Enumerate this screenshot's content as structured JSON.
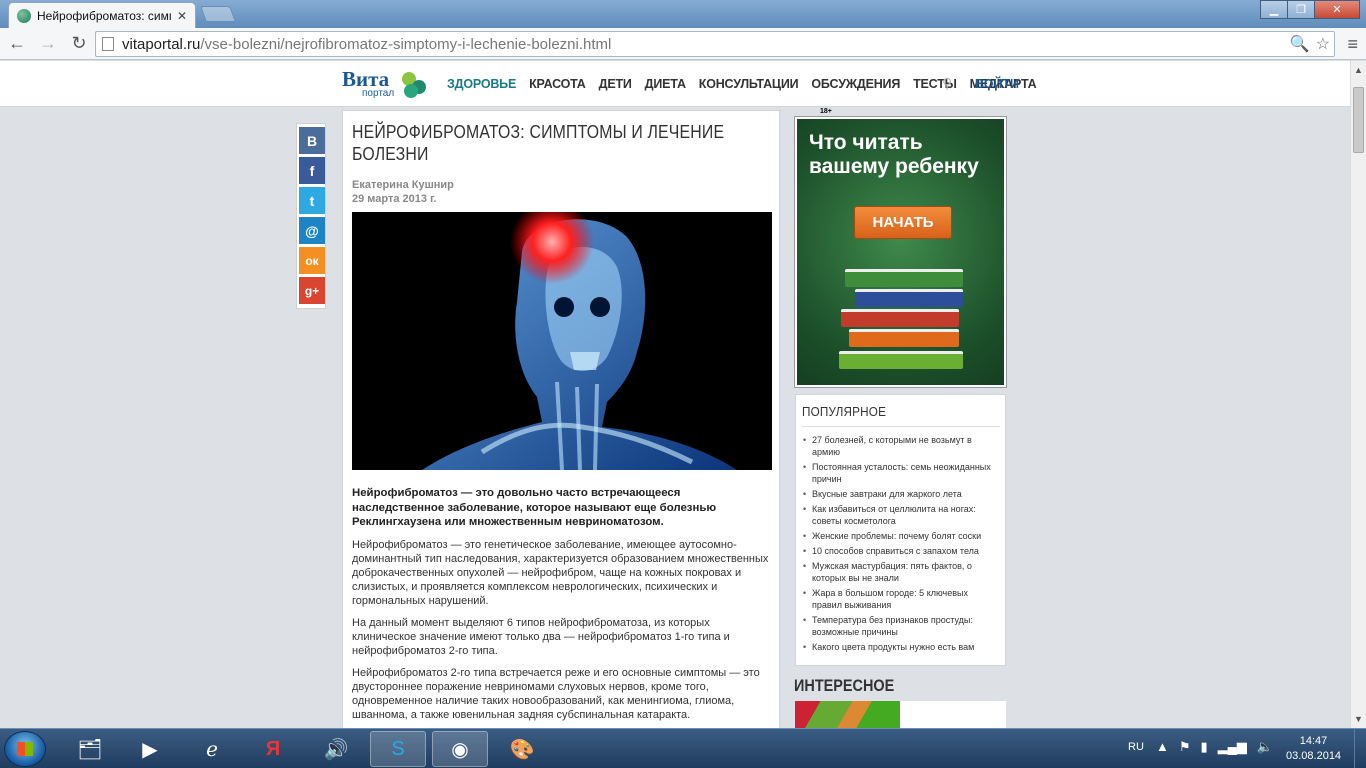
{
  "browser": {
    "tab_title": "Нейрофиброматоз: симг",
    "tab_close": "✕",
    "url_host": "vitaportal.ru",
    "url_path": "/vse-bolezni/nejrofibromatoz-simptomy-i-lechenie-bolezni.html",
    "window_buttons": {
      "minimize": "▁",
      "maximize": "❐",
      "close": "✕"
    }
  },
  "site": {
    "logo_word": "Вита",
    "logo_sub": "портал",
    "nav": [
      "ЗДОРОВЬЕ",
      "КРАСОТА",
      "ДЕТИ",
      "ДИЕТА",
      "КОНСУЛЬТАЦИИ",
      "ОБСУЖДЕНИЯ",
      "ТЕСТЫ",
      "МЕДКАРТА"
    ],
    "login": "ВОЙТИ"
  },
  "share": [
    {
      "label": "B",
      "color": "#4a6d9c",
      "icon": "vk-icon"
    },
    {
      "label": "f",
      "color": "#3b5a9a",
      "icon": "facebook-icon"
    },
    {
      "label": "t",
      "color": "#2fa9e1",
      "icon": "twitter-icon"
    },
    {
      "label": "@",
      "color": "#1e84c6",
      "icon": "mail-icon"
    },
    {
      "label": "ок",
      "color": "#f39021",
      "icon": "odnoklassniki-icon"
    },
    {
      "label": "g+",
      "color": "#d9452e",
      "icon": "googleplus-icon"
    }
  ],
  "article": {
    "title": "НЕЙРОФИБРОМАТОЗ: СИМПТОМЫ И ЛЕЧЕНИЕ БОЛЕЗНИ",
    "author": "Екатерина Кушнир",
    "date": "29 марта 2013 г.",
    "lead": "Нейрофиброматоз — это довольно часто встречающееся наследственное заболевание, которое называют еще болезнью Реклингхаузена или множественным невриноматозом.",
    "paragraphs": [
      "Нейрофиброматоз — это генетическое заболевание, имеющее аутосомно-доминантный тип наследования, характеризуется образованием множественных доброкачественных опухолей — нейрофибром, чаще на кожных покровах и слизистых, и проявляется комплексом неврологических, психических и гормональных нарушений.",
      "На данный момент выделяют 6 типов нейрофиброматоза, из которых клиническое значение имеют только два — нейрофиброматоз 1-го типа и нейрофиброматоз 2-го типа.",
      "Нейрофиброматоз 2-го типа встречается реже и его основные симптомы — это двустороннее поражение невриномами слуховых нервов, кроме того, одновременное наличие таких новообразований, как менингиома, глиома, шваннома, а также ювенильная задняя субспинальная катаракта."
    ]
  },
  "ad": {
    "age_label": "18+",
    "text": "Что читать вашему ребенку",
    "button": "НАЧАТЬ"
  },
  "popular": {
    "heading": "ПОПУЛЯРНОЕ",
    "items": [
      "27 болезней, с которыми не возьмут в армию",
      "Постоянная усталость: семь неожиданных причин",
      "Вкусные завтраки для жаркого лета",
      "Как избавиться от целлюлита на ногах: советы косметолога",
      "Женские проблемы: почему болят соски",
      "10 способов справиться с запахом тела",
      "Мужская мастурбация: пять фактов, о которых вы не знали",
      "Жара в большом городе: 5 ключевых правил выживания",
      "Температура без признаков простуды: возможные причины",
      "Какого цвета продукты нужно есть вам"
    ]
  },
  "interesting": {
    "heading": "ИНТЕРЕСНОЕ"
  },
  "taskbar": {
    "lang": "RU",
    "time": "14:47",
    "date": "03.08.2014"
  }
}
